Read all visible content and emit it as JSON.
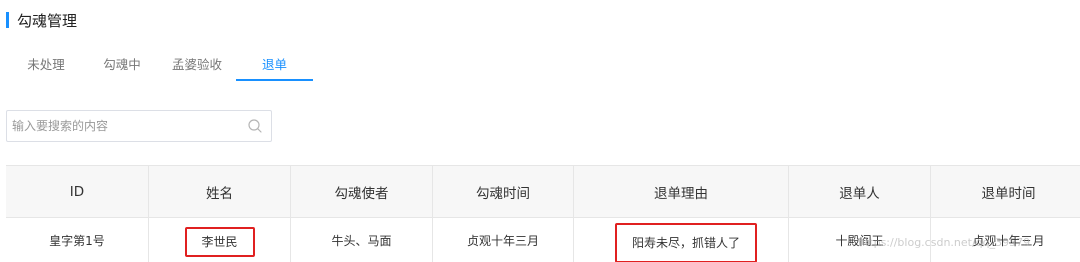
{
  "page": {
    "title": "勾魂管理",
    "accent_color": "#1890ff"
  },
  "tabs": [
    {
      "label": "未处理",
      "active": false
    },
    {
      "label": "勾魂中",
      "active": false
    },
    {
      "label": "孟婆验收",
      "active": false
    },
    {
      "label": "退单",
      "active": true
    }
  ],
  "search": {
    "placeholder": "输入要搜索的内容",
    "value": "",
    "icon": "search-icon"
  },
  "table": {
    "headers": [
      "ID",
      "姓名",
      "勾魂使者",
      "勾魂时间",
      "退单理由",
      "退单人",
      "退单时间"
    ],
    "rows": [
      [
        "皇字第1号",
        "李世民",
        "牛头、马面",
        "贞观十年三月",
        "阳寿未尽，抓错人了",
        "十殿阎王",
        "贞观十年三月"
      ]
    ]
  },
  "highlight_color": "#e02020",
  "watermark": "https://blog.csdn.net/qq_39579"
}
